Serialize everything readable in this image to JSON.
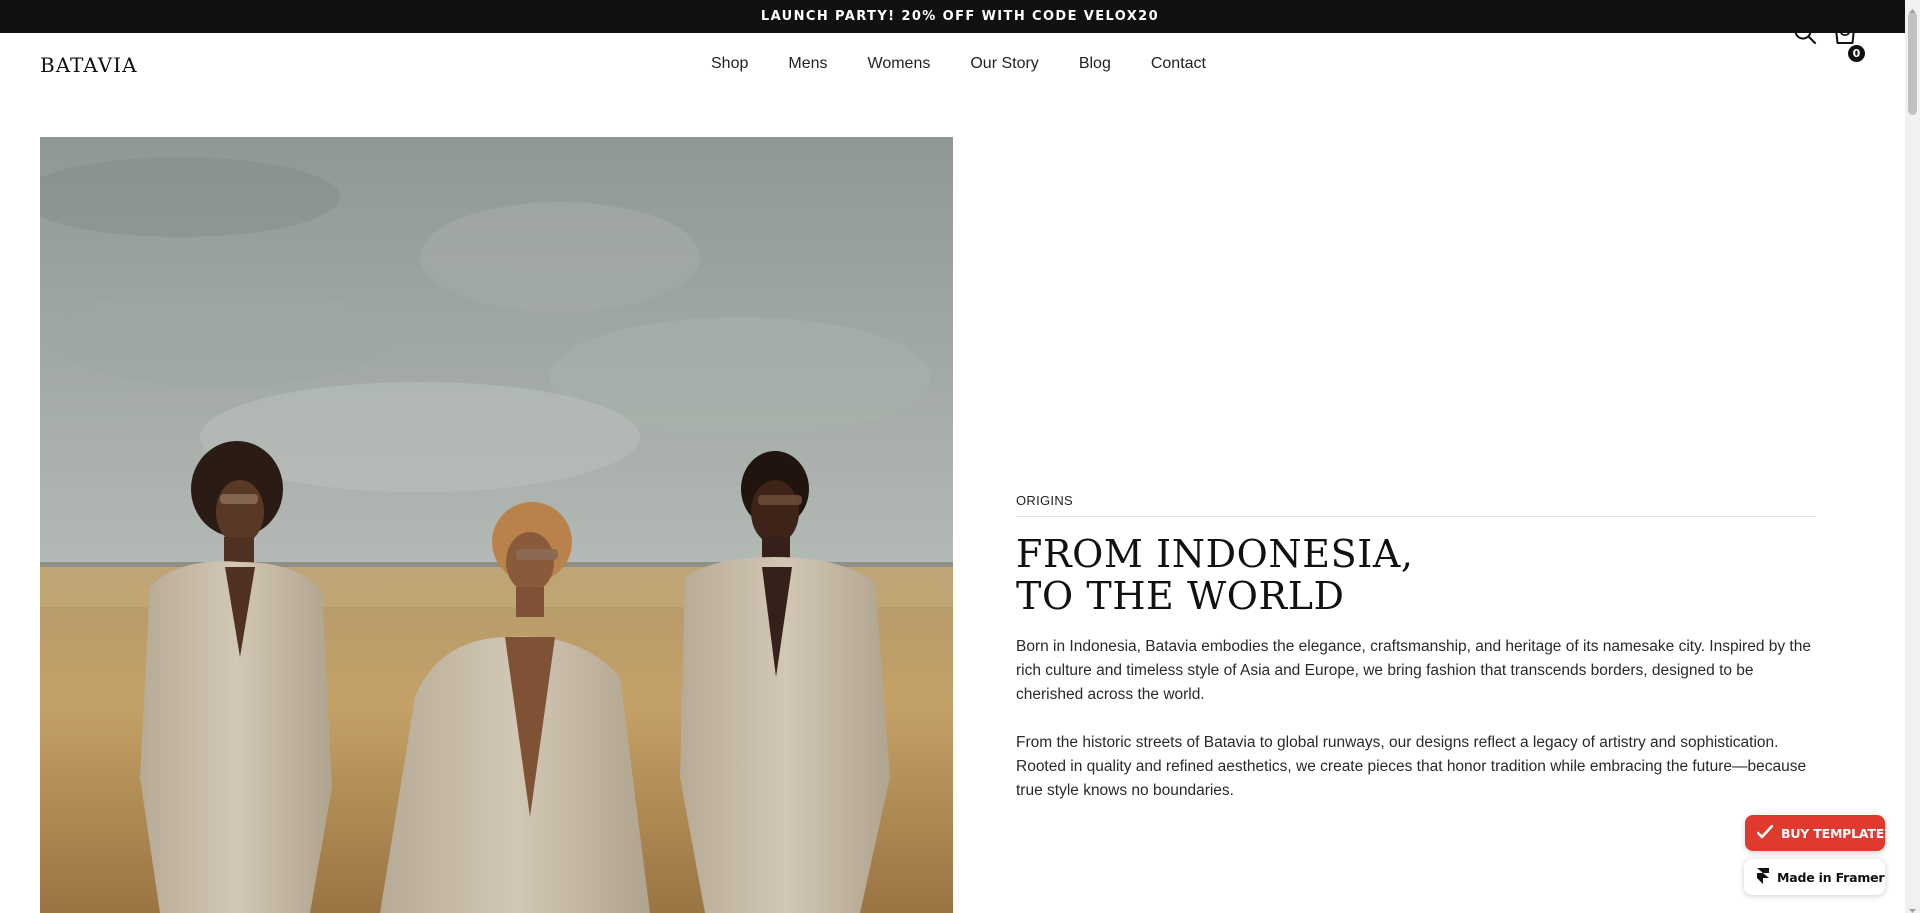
{
  "announcement": {
    "text": "LAUNCH PARTY! 20% OFF WITH CODE VELOX20"
  },
  "header": {
    "logo": "BATAVIA",
    "nav": [
      "Shop",
      "Mens",
      "Womens",
      "Our Story",
      "Blog",
      "Contact"
    ],
    "cart_count": "0",
    "icons": {
      "search": "search-icon",
      "cart": "shopping-bag-icon"
    }
  },
  "hero": {
    "image": "three-models-in-beige-suits-wheat-field-photo",
    "eyebrow": "ORIGINS",
    "title_line1": "FROM INDONESIA,",
    "title_line2": "TO THE WORLD",
    "paragraph1": "Born in Indonesia, Batavia embodies the elegance, craftsmanship, and heritage of its namesake city. Inspired by the rich culture and timeless style of Asia and Europe, we bring fashion that transcends borders, designed to be cherished across the world.",
    "paragraph2": "From the historic streets of Batavia to global runways, our designs reflect a legacy of artistry and sophistication. Rooted in quality and refined aesthetics, we create pieces that honor tradition while embracing the future—because true style knows no boundaries."
  },
  "badges": {
    "buy_template": "BUY TEMPLATE",
    "made_in_framer": "Made in Framer"
  },
  "colors": {
    "announcement_bg": "#111111",
    "buy_button": "#e03a2e",
    "text": "#1a1a1a"
  }
}
